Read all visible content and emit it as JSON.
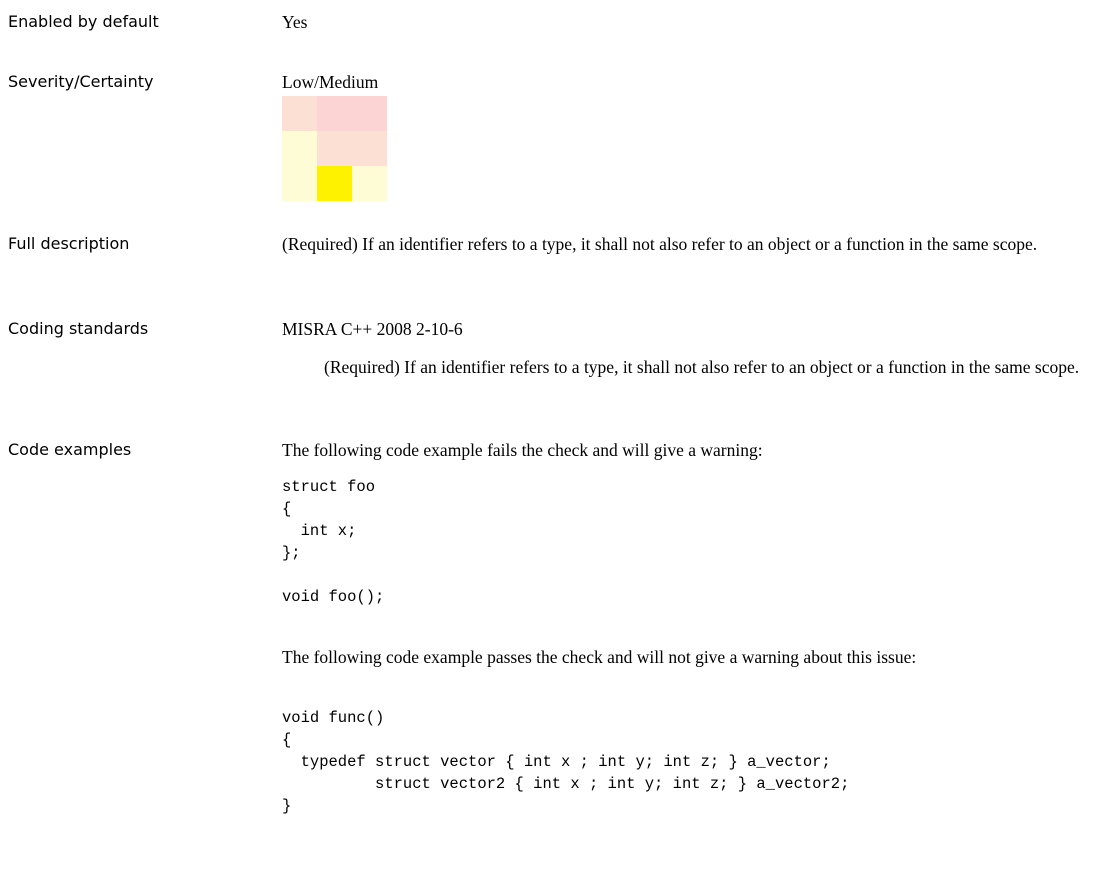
{
  "rows": {
    "enabled": {
      "label": "Enabled by default",
      "value": "Yes"
    },
    "severity": {
      "label": "Severity/Certainty",
      "value": "Low/Medium",
      "matrix": {
        "rows": 3,
        "cols": 3,
        "selected": {
          "row": 3,
          "col": 2
        },
        "colors": [
          [
            "#fce0d4",
            "#fdd4d4",
            "#fdd4d4"
          ],
          [
            "#fdfcd4",
            "#fce0d4",
            "#fce0d4"
          ],
          [
            "#fdfcd4",
            "#fff200",
            "#fdfcd4"
          ]
        ]
      }
    },
    "description": {
      "label": "Full description",
      "text": "(Required) If an identifier refers to a type, it shall not also refer to an object or a function in the same scope."
    },
    "standards": {
      "label": "Coding standards",
      "standard": "MISRA C++ 2008 2-10-6",
      "standard_text": "(Required) If an identifier refers to a type, it shall not also refer to an object or a function in the same scope."
    },
    "examples": {
      "label": "Code examples",
      "fail_intro": "The following code example fails the check and will give a warning:",
      "fail_code": "struct foo\n{\n  int x;\n};\n\nvoid foo();",
      "pass_intro": "The following code example passes the check and will not give a warning about this issue:",
      "pass_code": "void func()\n{\n  typedef struct vector { int x ; int y; int z; } a_vector;\n          struct vector2 { int x ; int y; int z; } a_vector2;\n}"
    }
  }
}
